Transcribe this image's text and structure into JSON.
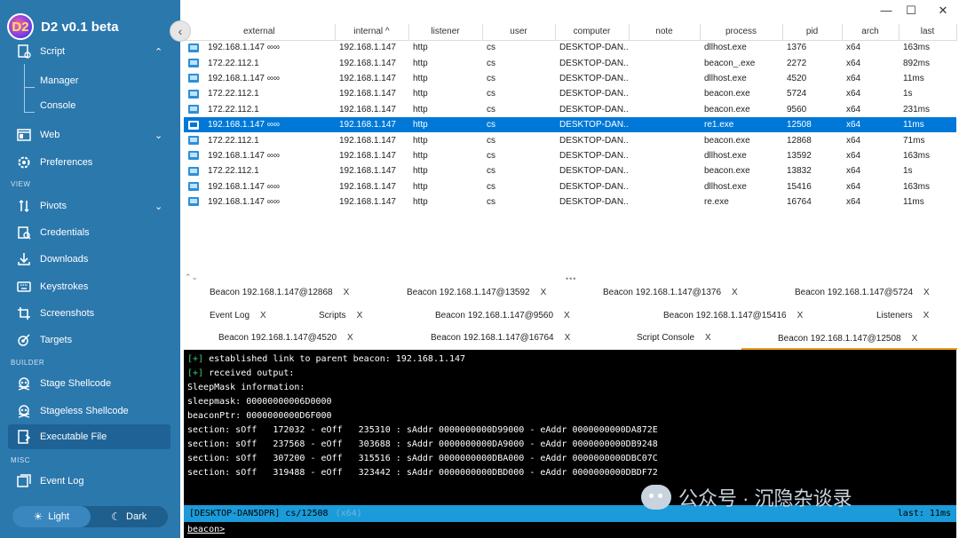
{
  "app": {
    "title": "D2 v0.1 beta",
    "logo_text": "D2"
  },
  "window": {
    "minimize": "—",
    "maximize": "☐",
    "close": "✕"
  },
  "sidebar": {
    "collapse_icon": "‹",
    "items": [
      {
        "label": "Script",
        "icon": "script-icon",
        "chevron": "⌃"
      },
      {
        "label": "Manager"
      },
      {
        "label": "Console"
      },
      {
        "label": "Web",
        "icon": "web-icon",
        "chevron": "⌄"
      },
      {
        "label": "Preferences",
        "icon": "gear-icon"
      },
      {
        "label": "Pivots",
        "icon": "pivot-icon",
        "chevron": "⌄"
      },
      {
        "label": "Credentials",
        "icon": "credentials-icon"
      },
      {
        "label": "Downloads",
        "icon": "download-icon"
      },
      {
        "label": "Keystrokes",
        "icon": "keyboard-icon"
      },
      {
        "label": "Screenshots",
        "icon": "screenshot-icon"
      },
      {
        "label": "Targets",
        "icon": "target-icon"
      },
      {
        "label": "Stage Shellcode",
        "icon": "skull-icon"
      },
      {
        "label": "Stageless Shellcode",
        "icon": "skull-icon"
      },
      {
        "label": "Executable File",
        "icon": "file-icon"
      },
      {
        "label": "Event Log",
        "icon": "eventlog-icon"
      }
    ],
    "sections": {
      "view": "VIEW",
      "builder": "BUILDER",
      "misc": "MISC"
    },
    "theme": {
      "light": "Light",
      "dark": "Dark"
    }
  },
  "table": {
    "columns": [
      "external",
      "internal ^",
      "listener",
      "user",
      "computer",
      "note",
      "process",
      "pid",
      "arch",
      "last"
    ],
    "rows": [
      [
        "192.168.1.147 ∞∞",
        "192.168.1.147",
        "http",
        "cs",
        "DESKTOP-DAN...",
        "",
        "dllhost.exe",
        "1376",
        "x64",
        "163ms"
      ],
      [
        "172.22.112.1",
        "192.168.1.147",
        "http",
        "cs",
        "DESKTOP-DAN...",
        "",
        "beacon_.exe",
        "2272",
        "x64",
        "892ms"
      ],
      [
        "192.168.1.147 ∞∞",
        "192.168.1.147",
        "http",
        "cs",
        "DESKTOP-DAN...",
        "",
        "dllhost.exe",
        "4520",
        "x64",
        "11ms"
      ],
      [
        "172.22.112.1",
        "192.168.1.147",
        "http",
        "cs",
        "DESKTOP-DAN...",
        "",
        "beacon.exe",
        "5724",
        "x64",
        "1s"
      ],
      [
        "172.22.112.1",
        "192.168.1.147",
        "http",
        "cs",
        "DESKTOP-DAN...",
        "",
        "beacon.exe",
        "9560",
        "x64",
        "231ms"
      ],
      [
        "192.168.1.147 ∞∞",
        "192.168.1.147",
        "http",
        "cs",
        "DESKTOP-DAN...",
        "",
        "re1.exe",
        "12508",
        "x64",
        "11ms"
      ],
      [
        "172.22.112.1",
        "192.168.1.147",
        "http",
        "cs",
        "DESKTOP-DAN...",
        "",
        "beacon.exe",
        "12868",
        "x64",
        "71ms"
      ],
      [
        "192.168.1.147 ∞∞",
        "192.168.1.147",
        "http",
        "cs",
        "DESKTOP-DAN...",
        "",
        "dllhost.exe",
        "13592",
        "x64",
        "163ms"
      ],
      [
        "172.22.112.1",
        "192.168.1.147",
        "http",
        "cs",
        "DESKTOP-DAN...",
        "",
        "beacon.exe",
        "13832",
        "x64",
        "1s"
      ],
      [
        "192.168.1.147 ∞∞",
        "192.168.1.147",
        "http",
        "cs",
        "DESKTOP-DAN...",
        "",
        "dllhost.exe",
        "15416",
        "x64",
        "163ms"
      ],
      [
        "192.168.1.147 ∞∞",
        "192.168.1.147",
        "http",
        "cs",
        "DESKTOP-DAN...",
        "",
        "re.exe",
        "16764",
        "x64",
        "11ms"
      ]
    ],
    "selected_row": 5
  },
  "splitter": {
    "dots": "•••",
    "chevrons": "⌃⌄"
  },
  "tabs": [
    {
      "label": "Beacon 192.168.1.147@12868",
      "close": "X"
    },
    {
      "label": "Beacon 192.168.1.147@13592",
      "close": "X"
    },
    {
      "label": "Beacon 192.168.1.147@1376",
      "close": "X"
    },
    {
      "label": "Beacon 192.168.1.147@5724",
      "close": "X"
    },
    {
      "label": "Event Log",
      "close": "X"
    },
    {
      "label": "Scripts",
      "close": "X"
    },
    {
      "label": "Beacon 192.168.1.147@9560",
      "close": "X"
    },
    {
      "label": "Beacon 192.168.1.147@15416",
      "close": "X"
    },
    {
      "label": "Listeners",
      "close": "X"
    },
    {
      "label": "Beacon 192.168.1.147@4520",
      "close": "X"
    },
    {
      "label": "Beacon 192.168.1.147@16764",
      "close": "X"
    },
    {
      "label": "Script Console",
      "close": "X"
    },
    {
      "label": "Beacon 192.168.1.147@12508",
      "close": "X"
    }
  ],
  "console": {
    "lines": [
      {
        "prefix": "[+]",
        "text": " established link to parent beacon: 192.168.1.147"
      },
      {
        "prefix": "[+]",
        "text": " received output:"
      },
      {
        "prefix": "",
        "text": "SleepMask information:"
      },
      {
        "prefix": "",
        "text": "sleepmask: 00000000006D0000"
      },
      {
        "prefix": "",
        "text": "beaconPtr: 0000000000D6F000"
      },
      {
        "prefix": "",
        "text": "section: sOff   172032 - eOff   235310 : sAddr 0000000000D99000 - eAddr 0000000000DA872E"
      },
      {
        "prefix": "",
        "text": "section: sOff   237568 - eOff   303688 : sAddr 0000000000DA9000 - eAddr 0000000000DB9248"
      },
      {
        "prefix": "",
        "text": "section: sOff   307200 - eOff   315516 : sAddr 0000000000DBA000 - eAddr 0000000000DBC07C"
      },
      {
        "prefix": "",
        "text": "section: sOff   319488 - eOff   323442 : sAddr 0000000000DBD000 - eAddr 0000000000DBDF72"
      }
    ],
    "status_left": "[DESKTOP-DAN5DPR] cs/12508",
    "status_dim": "(x64)",
    "status_right": "last: 11ms",
    "prompt": "beacon>"
  },
  "watermark": {
    "text": "公众号 · 沉隐杂谈录"
  },
  "colors": {
    "sidebar": "#2b78ad",
    "selected_row": "#0078d7",
    "status_bar": "#1b9bd9",
    "active_tab": "#f0a020"
  }
}
